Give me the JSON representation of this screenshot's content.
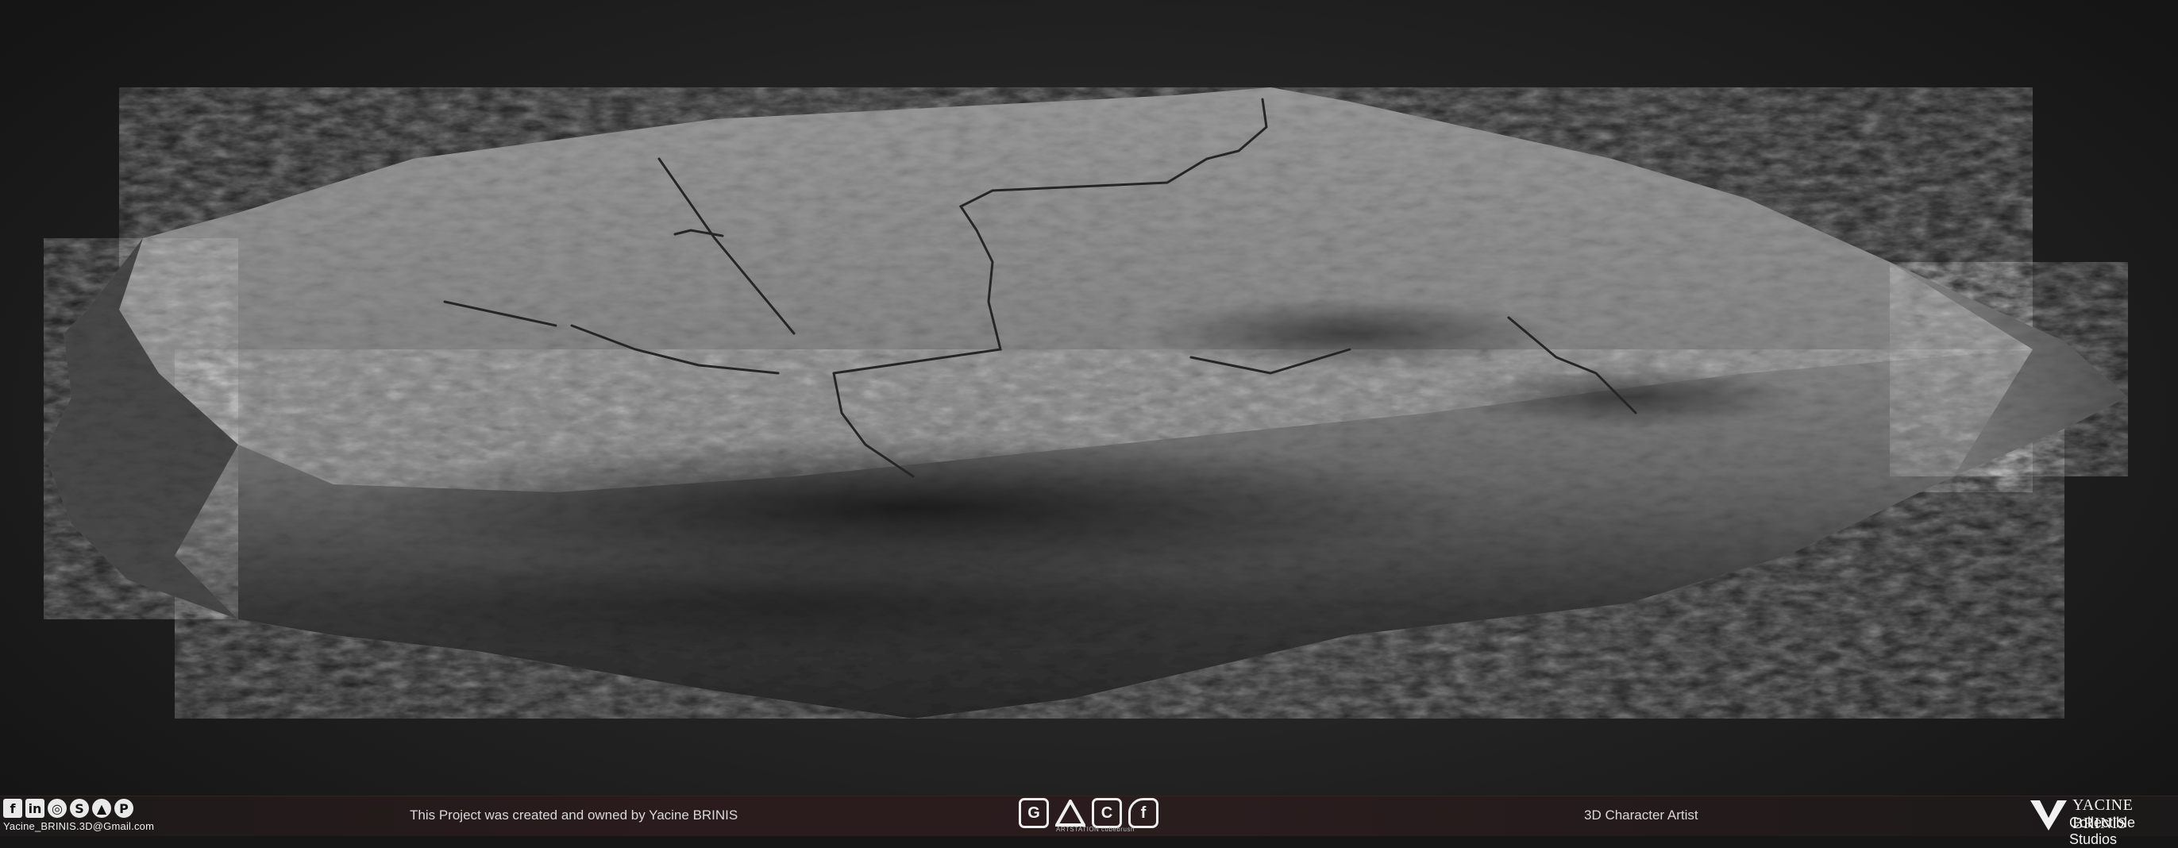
{
  "footer": {
    "social_icons": [
      "facebook-icon",
      "linkedin-icon",
      "instagram-icon",
      "skype-icon",
      "artstation-icon",
      "pinterest-icon"
    ],
    "email": "Yacine_BRINIS.3D@Gmail.com",
    "credit": "This Project was created and owned by Yacine BRINIS",
    "center_logos": [
      "gumroad-icon",
      "artstation-icon",
      "cubebrush-icon",
      "flippednormals-icon"
    ],
    "center_logo_subtext": "ARTSTATION  cubebrush",
    "role": "3D Character Artist",
    "brand_name": "YACINE BRINIS",
    "brand_sub": "Collectible Studios"
  },
  "colors": {
    "background": "#1f1f1f",
    "rock_light": "#bdbdbd",
    "rock_dark": "#2a2a2a",
    "footer_bg": "#2a1d1e"
  }
}
